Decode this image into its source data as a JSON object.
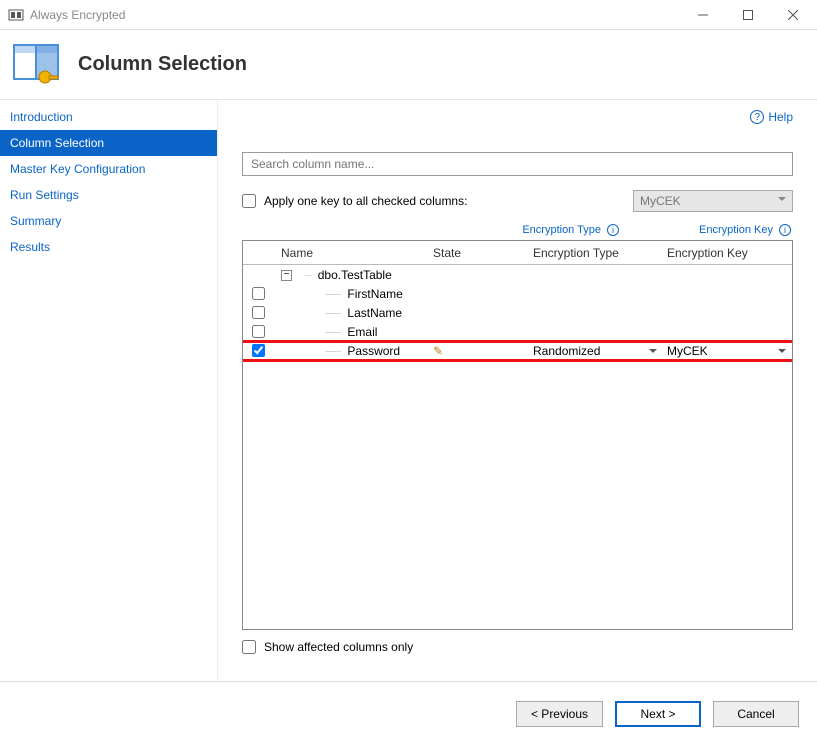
{
  "window": {
    "title": "Always Encrypted"
  },
  "header": {
    "title": "Column Selection"
  },
  "help": {
    "label": "Help"
  },
  "sidebar": {
    "items": [
      {
        "label": "Introduction"
      },
      {
        "label": "Column Selection"
      },
      {
        "label": "Master Key Configuration"
      },
      {
        "label": "Run Settings"
      },
      {
        "label": "Summary"
      },
      {
        "label": "Results"
      }
    ],
    "activeIndex": 1
  },
  "search": {
    "placeholder": "Search column name..."
  },
  "applyKey": {
    "label": "Apply one key to all checked columns:",
    "comboValue": "MyCEK"
  },
  "infoLinks": {
    "encType": "Encryption Type",
    "encKey": "Encryption Key"
  },
  "grid": {
    "headers": {
      "name": "Name",
      "state": "State",
      "encType": "Encryption Type",
      "encKey": "Encryption Key"
    },
    "tableName": "dbo.TestTable",
    "rows": [
      {
        "checked": false,
        "name": "FirstName",
        "encType": "",
        "encKey": ""
      },
      {
        "checked": false,
        "name": "LastName",
        "encType": "",
        "encKey": ""
      },
      {
        "checked": false,
        "name": "Email",
        "encType": "",
        "encKey": ""
      },
      {
        "checked": true,
        "name": "Password",
        "encType": "Randomized",
        "encKey": "MyCEK"
      }
    ],
    "highlightRowIndex": 3
  },
  "affected": {
    "label": "Show affected columns only"
  },
  "footer": {
    "prev": "< Previous",
    "next": "Next >",
    "cancel": "Cancel"
  }
}
